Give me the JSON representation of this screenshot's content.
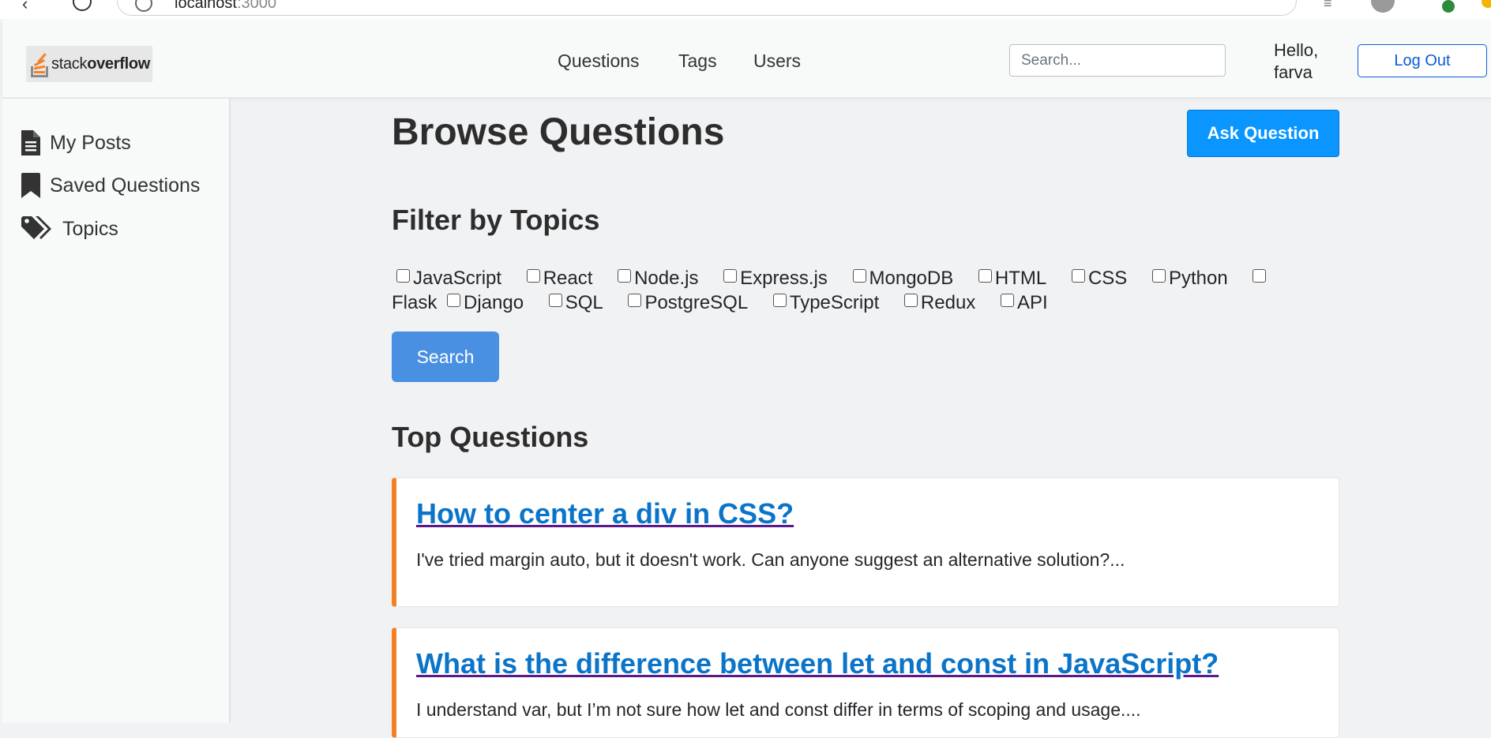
{
  "browser": {
    "url_host": "localhost",
    "url_port": ":3000"
  },
  "header": {
    "logo": {
      "prefix": "stack",
      "bold": "overflow"
    },
    "nav": [
      "Questions",
      "Tags",
      "Users"
    ],
    "search_placeholder": "Search...",
    "greeting": "Hello, farva",
    "logout_label": "Log Out"
  },
  "sidebar": {
    "items": [
      {
        "label": "My Posts",
        "icon": "file-text-icon"
      },
      {
        "label": "Saved Questions",
        "icon": "bookmark-icon"
      },
      {
        "label": "Topics",
        "icon": "tags-icon"
      }
    ]
  },
  "main": {
    "title": "Browse Questions",
    "ask_label": "Ask Question",
    "filter_title": "Filter by Topics",
    "topics": [
      "JavaScript",
      "React",
      "Node.js",
      "Express.js",
      "MongoDB",
      "HTML",
      "CSS",
      "Python",
      "Flask",
      "Django",
      "SQL",
      "PostgreSQL",
      "TypeScript",
      "Redux",
      "API"
    ],
    "search_label": "Search",
    "top_title": "Top Questions",
    "questions": [
      {
        "title": "How to center a div in CSS?",
        "excerpt": "I've tried margin auto, but it doesn't work. Can anyone suggest an alternative solution?..."
      },
      {
        "title": "What is the difference between let and const in JavaScript?",
        "excerpt": "I understand var, but I’m not sure how let and const differ in terms of scoping and usage...."
      }
    ]
  },
  "colors": {
    "accent_orange": "#f48024",
    "link_blue": "#0a74c9",
    "ask_button": "#0a95ff",
    "search_button": "#4a90e2"
  }
}
